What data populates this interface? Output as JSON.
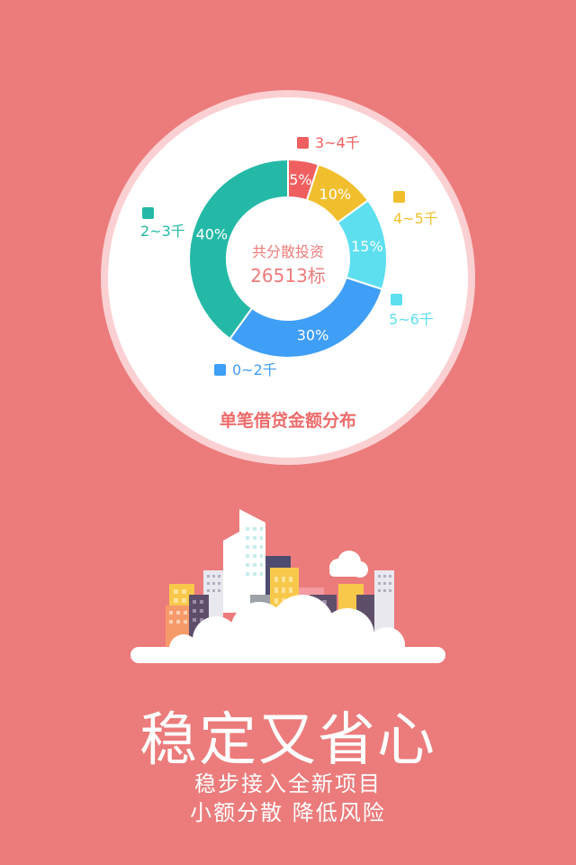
{
  "chart": {
    "center_label": "共分散投资",
    "center_value": "26513标",
    "caption": "单笔借贷金额分布"
  },
  "chart_data": {
    "type": "pie",
    "categories": [
      "3~4千",
      "4~5千",
      "5~6千",
      "0~2千",
      "2~3千"
    ],
    "values": [
      5,
      10,
      15,
      30,
      40
    ],
    "value_labels": [
      "5%",
      "10%",
      "15%",
      "30%",
      "40%"
    ],
    "colors": [
      "#ef5f5f",
      "#f1bf2e",
      "#5ddff0",
      "#3f9ef5",
      "#24b9a6"
    ]
  },
  "headline": "稳定又省心",
  "subline1": "稳步接入全新项目",
  "subline2": "小额分散 降低风险"
}
